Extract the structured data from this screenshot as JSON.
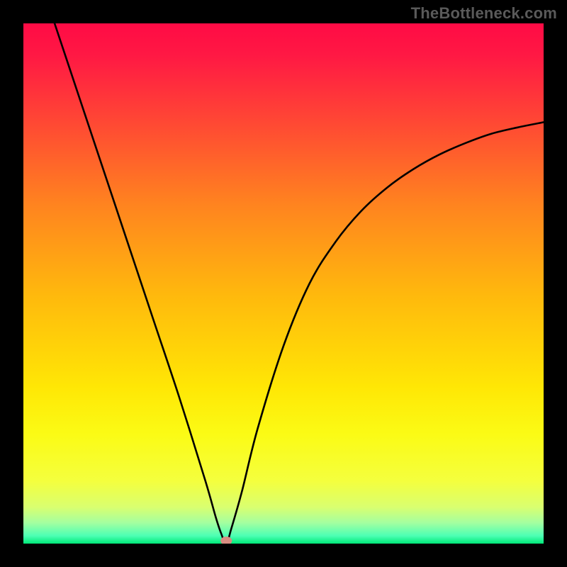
{
  "watermark": "TheBottleneck.com",
  "chart_data": {
    "type": "line",
    "title": "",
    "xlabel": "",
    "ylabel": "",
    "xlim": [
      0,
      100
    ],
    "ylim": [
      0,
      100
    ],
    "grid": false,
    "legend": false,
    "series": [
      {
        "name": "bottleneck-curve",
        "x": [
          6,
          10,
          15,
          20,
          25,
          30,
          35,
          37,
          38,
          39,
          40,
          42,
          45,
          50,
          55,
          60,
          65,
          70,
          75,
          80,
          85,
          90,
          95,
          100
        ],
        "y": [
          100,
          88,
          73,
          58,
          43,
          28,
          12,
          5,
          2,
          0,
          3,
          10,
          22,
          38,
          50,
          58,
          64,
          68.5,
          72,
          74.8,
          77,
          78.8,
          80,
          81
        ]
      }
    ],
    "marker": {
      "x": 39,
      "y": 0
    },
    "gradient_stops": [
      {
        "offset": 0,
        "color": "#ff0b45"
      },
      {
        "offset": 0.06,
        "color": "#ff1844"
      },
      {
        "offset": 0.18,
        "color": "#ff4435"
      },
      {
        "offset": 0.35,
        "color": "#ff841f"
      },
      {
        "offset": 0.52,
        "color": "#ffb80d"
      },
      {
        "offset": 0.7,
        "color": "#ffe705"
      },
      {
        "offset": 0.79,
        "color": "#fbfb15"
      },
      {
        "offset": 0.88,
        "color": "#f4ff3e"
      },
      {
        "offset": 0.93,
        "color": "#d9ff70"
      },
      {
        "offset": 0.96,
        "color": "#a4ffa0"
      },
      {
        "offset": 0.985,
        "color": "#4cffb4"
      },
      {
        "offset": 1.0,
        "color": "#00e878"
      }
    ]
  }
}
